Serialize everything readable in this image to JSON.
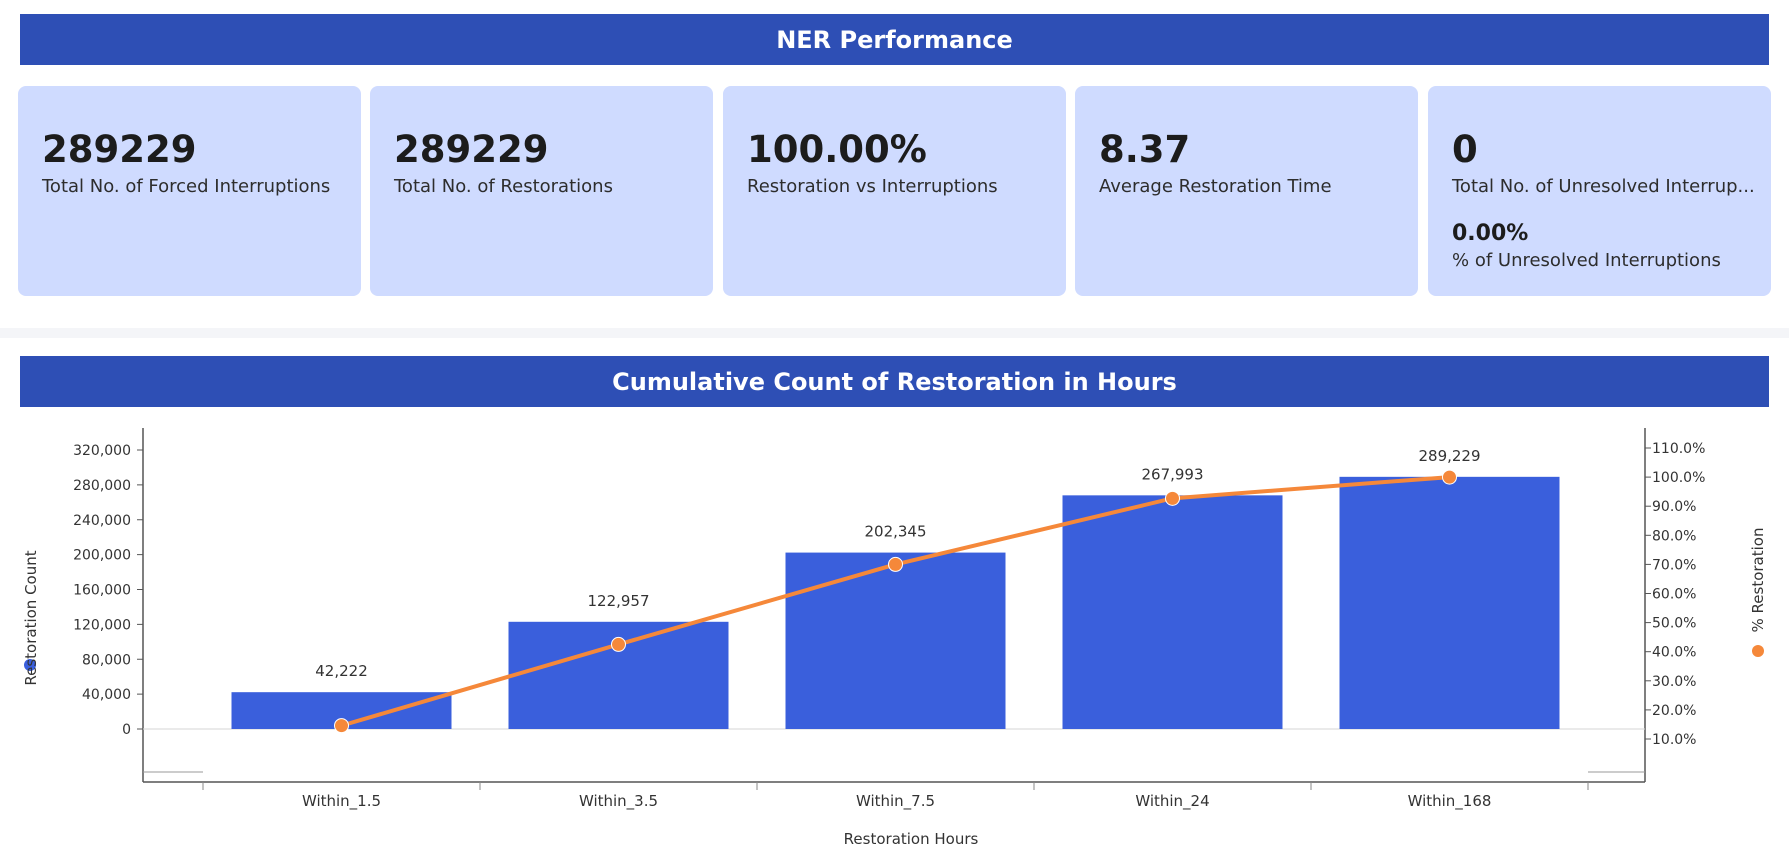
{
  "header": {
    "title": "NER Performance"
  },
  "kpis": [
    {
      "value": "289229",
      "label": "Total No. of Forced Interruptions"
    },
    {
      "value": "289229",
      "label": "Total No. of Restorations"
    },
    {
      "value": "100.00%",
      "label": "Restoration vs Interruptions"
    },
    {
      "value": "8.37",
      "label": "Average Restoration Time"
    },
    {
      "value": "0",
      "label": "Total No. of Unresolved Interrup...",
      "sub_value": "0.00%",
      "sub_label": "% of Unresolved Interruptions"
    }
  ],
  "chart_section": {
    "title": "Cumulative Count of Restoration in Hours"
  },
  "chart_data": {
    "type": "bar",
    "categories": [
      "Within_1.5",
      "Within_3.5",
      "Within_7.5",
      "Within_24",
      "Within_168"
    ],
    "series": [
      {
        "name": "Restoration Count",
        "type": "bar",
        "axis": "left",
        "color": "#3a5fdc",
        "values": [
          42222,
          122957,
          202345,
          267993,
          289229
        ],
        "labels": [
          "42,222",
          "122,957",
          "202,345",
          "267,993",
          "289,229"
        ]
      },
      {
        "name": "% Restoration",
        "type": "line",
        "axis": "right",
        "color": "#f5883a",
        "values": [
          14.6,
          42.5,
          70.0,
          92.7,
          100.0
        ]
      }
    ],
    "xlabel": "Restoration Hours",
    "ylabel_left": "Restoration Count",
    "ylabel_right": "% Restoration",
    "left_ticks": [
      "320,000",
      "280,000",
      "240,000",
      "200,000",
      "160,000",
      "120,000",
      "80,000",
      "40,000",
      "0"
    ],
    "right_ticks": [
      "110.0%",
      "100.0%",
      "90.0%",
      "80.0%",
      "70.0%",
      "60.0%",
      "50.0%",
      "40.0%",
      "30.0%",
      "20.0%",
      "10.0%"
    ],
    "ylim_left": [
      0,
      320000
    ],
    "ylim_right": [
      10,
      110
    ],
    "grid": false,
    "legend": "axis-titles"
  }
}
